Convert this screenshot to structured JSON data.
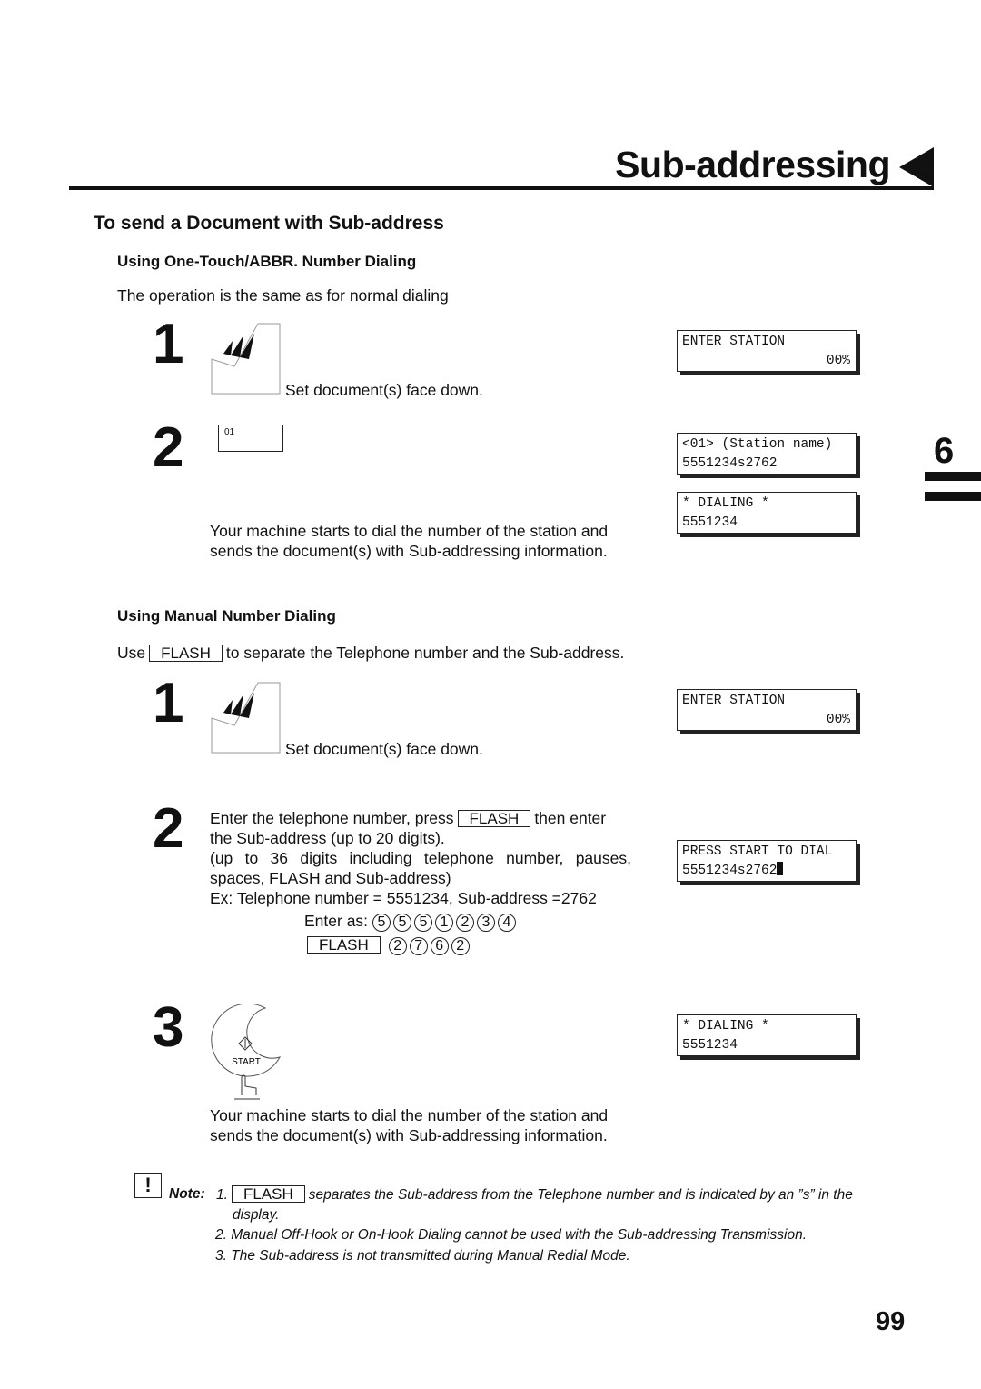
{
  "title": "Sub-addressing",
  "section_title": "To send a Document with Sub-address",
  "chapter_tab": "6",
  "page_number": "99",
  "part1": {
    "heading": "Using One-Touch/ABBR. Number Dialing",
    "intro": "The operation is the same as for normal dialing",
    "step1": {
      "number": "1",
      "text": "Set document(s) face down."
    },
    "step2": {
      "number": "2",
      "key_label": "01",
      "text1": "Your machine starts to dial the number of the station and",
      "text2": "sends the document(s) with Sub-addressing information."
    },
    "lcd1": {
      "line1": "ENTER STATION",
      "line2": "00%"
    },
    "lcd2": {
      "line1": "<01> (Station name)",
      "line2": "5551234s2762"
    },
    "lcd3": {
      "line1": "* DIALING *",
      "line2": "5551234"
    }
  },
  "part2": {
    "heading": "Using Manual Number Dialing",
    "intro_pre": "Use",
    "intro_key": "FLASH",
    "intro_post": "to separate the Telephone number and the Sub-address.",
    "step1": {
      "number": "1",
      "text": "Set document(s) face down."
    },
    "step2": {
      "number": "2",
      "l1_pre": "Enter the telephone number, press",
      "l1_key": "FLASH",
      "l1_post": "then enter",
      "l2": "the Sub-address (up to 20 digits).",
      "l3": "(up to 36 digits including telephone number, pauses,",
      "l4": "spaces, FLASH and Sub-address)",
      "l5": "Ex: Telephone number = 5551234, Sub-address =2762",
      "enter_as": "Enter as:",
      "digits1": [
        "5",
        "5",
        "5",
        "1",
        "2",
        "3",
        "4"
      ],
      "flash_key": "FLASH",
      "digits2": [
        "2",
        "7",
        "6",
        "2"
      ]
    },
    "step3": {
      "number": "3",
      "button_label": "START",
      "text1": "Your machine starts to dial the number of the station and",
      "text2": "sends the document(s) with Sub-addressing information."
    },
    "lcd1": {
      "line1": "ENTER STATION",
      "line2": "00%"
    },
    "lcd2": {
      "line1": "PRESS START TO DIAL",
      "line2": "5551234s2762"
    },
    "lcd3": {
      "line1": "* DIALING *",
      "line2": "5551234"
    }
  },
  "note": {
    "label": "Note:",
    "n1_num": "1.",
    "n1_key": "FLASH",
    "n1_text": "separates the Sub-address from the Telephone number and is indicated by an ”s” in the",
    "n1_cont": "display.",
    "n2": "2. Manual Off-Hook or On-Hook Dialing cannot be used with the Sub-addressing Transmission.",
    "n3": "3. The Sub-address is not transmitted during Manual Redial Mode."
  }
}
